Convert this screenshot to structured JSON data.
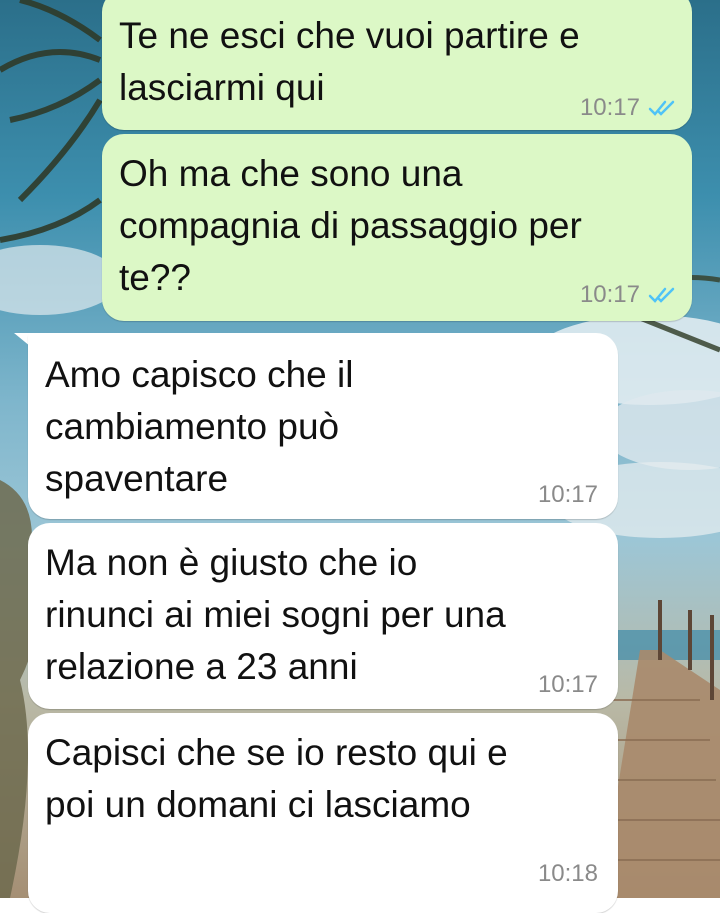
{
  "messages": [
    {
      "direction": "outgoing",
      "text": "Te ne esci che vuoi partire e\nlasciarmi qui",
      "time": "10:17",
      "status_icon": "double-check-read-icon"
    },
    {
      "direction": "outgoing",
      "text": "Oh ma che sono una\ncompagnia di passaggio per\nte??",
      "time": "10:17",
      "status_icon": "double-check-read-icon"
    },
    {
      "direction": "incoming",
      "text": "Amo capisco che il\ncambiamento può\nspaventare",
      "time": "10:17"
    },
    {
      "direction": "incoming",
      "text": "Ma non è giusto che io\nrinunci ai miei sogni per una\nrelazione a 23 anni",
      "time": "10:17"
    },
    {
      "direction": "incoming",
      "text": "Capisci che se io resto qui e\npoi un domani ci lasciamo",
      "time": "10:18"
    }
  ],
  "colors": {
    "outgoing_bubble": "#dcf8c6",
    "incoming_bubble": "#ffffff",
    "read_ticks": "#4fc3f7",
    "meta_text": "#8a8a8a"
  }
}
